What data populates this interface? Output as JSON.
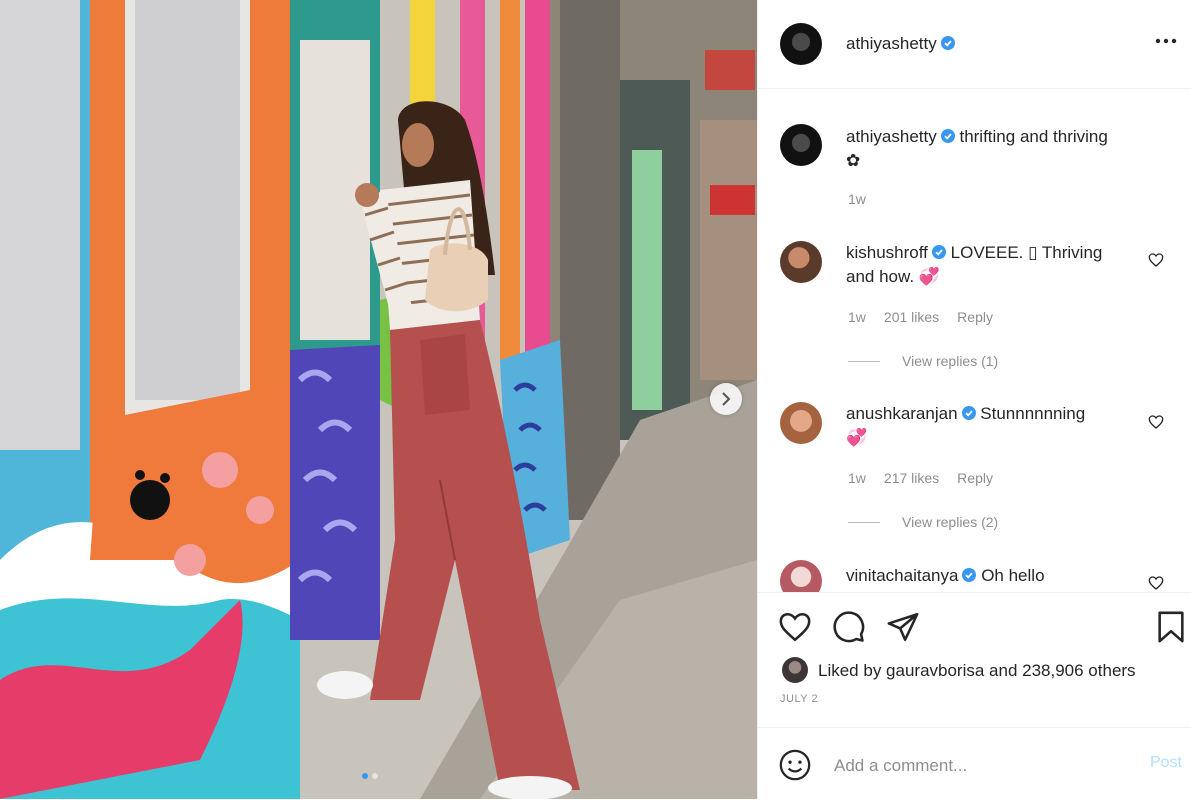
{
  "post": {
    "author": "athiyashetty",
    "more_icon": "more-horizontal-icon"
  },
  "caption": {
    "username": "athiyashetty",
    "text": "thrifting and thriving",
    "emoji": "✿",
    "time": "1w"
  },
  "comments": [
    {
      "username": "kishushroff",
      "text_line1": "LOVEEE. ▯ Thriving",
      "text_line2": "and how. 💞",
      "time": "1w",
      "likes": "201 likes",
      "reply": "Reply",
      "view_replies": "View replies (1)"
    },
    {
      "username": "anushkaranjan",
      "text_line1": "Stunnnnnning",
      "text_line2": "💞",
      "time": "1w",
      "likes": "217 likes",
      "reply": "Reply",
      "view_replies": "View replies (2)"
    },
    {
      "username": "vinitachaitanya",
      "text_line1": "Oh hello"
    }
  ],
  "actions": {
    "liked_by_prefix": "Liked by ",
    "liked_by_user": "gauravborisa",
    "liked_by_suffix": " and 238,906 others",
    "date": "JULY 2"
  },
  "add_comment": {
    "placeholder": "Add a comment...",
    "post_label": "Post"
  },
  "colors": {
    "verified": "#3897f0",
    "post_button": "#b2dffc",
    "muted_text": "#8e8e8e"
  }
}
